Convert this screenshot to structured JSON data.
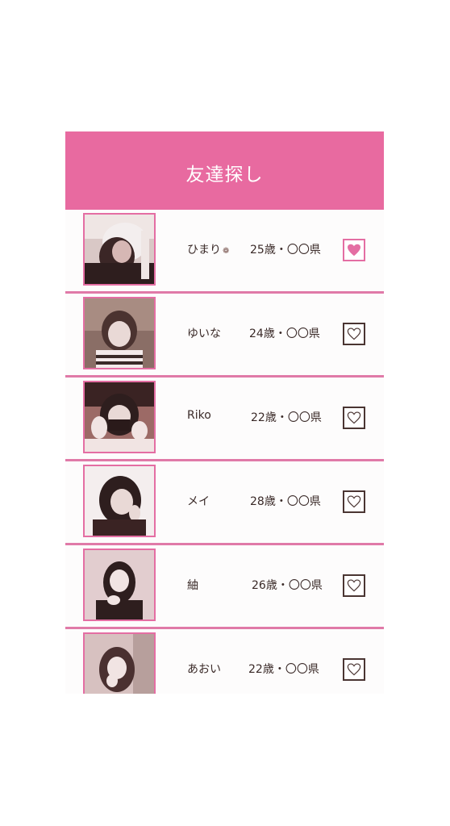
{
  "header": {
    "title": "友達探し"
  },
  "users": [
    {
      "name": "ひまり",
      "flower": "❁",
      "age": "25歳・〇〇県",
      "liked": true
    },
    {
      "name": "ゆいな",
      "age": "24歳・〇〇県",
      "liked": false
    },
    {
      "name": "Riko",
      "age": "22歳・〇〇県",
      "liked": false
    },
    {
      "name": "メイ",
      "age": "28歳・〇〇県",
      "liked": false
    },
    {
      "name": "紬",
      "age": "26歳・〇〇県",
      "liked": false
    },
    {
      "name": "あおい",
      "age": "22歳・〇〇県",
      "liked": false
    }
  ],
  "colors": {
    "accent": "#e86aa0",
    "text": "#3a2a28",
    "heart_active": "#e46ea3"
  },
  "icons": {
    "heart_outline": "heart-outline-icon",
    "heart_filled": "heart-filled-icon"
  }
}
